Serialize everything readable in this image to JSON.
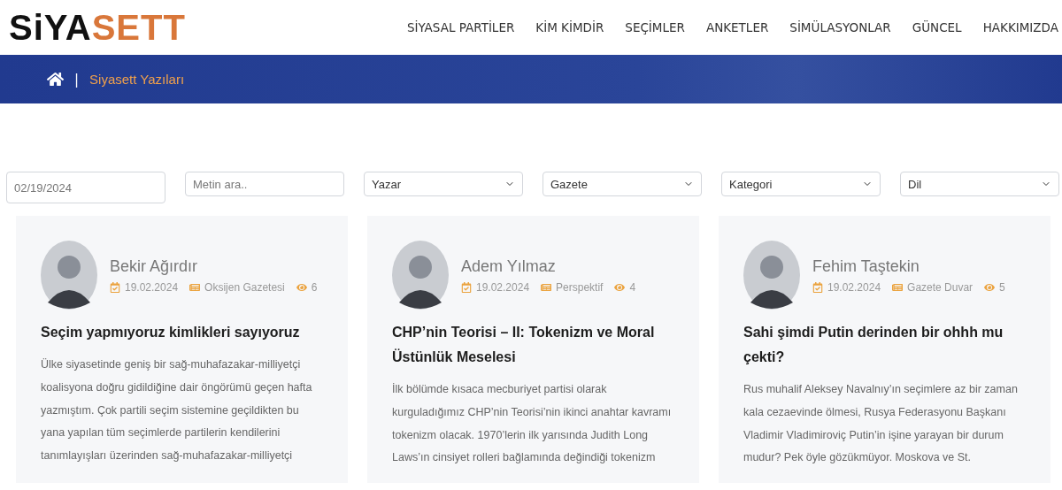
{
  "logo": {
    "dark": "SiYA",
    "accent": "SETT"
  },
  "nav": [
    "SİYASAL PARTİLER",
    "KİM KİMDİR",
    "SEÇİMLER",
    "ANKETLER",
    "SİMÜLASYONLAR",
    "GÜNCEL",
    "HAKKIMIZDA"
  ],
  "breadcrumb": {
    "separator": "|",
    "current": "Siyasett Yazıları"
  },
  "filters": [
    {
      "kind": "date",
      "placeholder": "02/19/2024"
    },
    {
      "kind": "text",
      "placeholder": "Metin ara.."
    },
    {
      "kind": "select",
      "value": "Yazar"
    },
    {
      "kind": "select",
      "value": "Gazete"
    },
    {
      "kind": "select",
      "value": "Kategori"
    },
    {
      "kind": "select",
      "value": "Dil"
    }
  ],
  "articles": [
    {
      "author": "Bekir Ağırdır",
      "date": "19.02.2024",
      "source": "Oksijen Gazetesi",
      "views": "6",
      "title": "Seçim yapmıyoruz kimlikleri sayıyoruz",
      "excerpt": "Ülke siyasetinde geniş bir sağ-muhafazakar-milliyetçi koalisyona doğru gidildiğine dair öngörümü geçen hafta yazmıştım. Çok partili seçim sistemine geçildikten bu yana yapılan tüm seçimlerde partilerin kendilerini tanımlayışları üzerinden sağ-muhafazakar-milliyetçi"
    },
    {
      "author": "Adem Yılmaz",
      "date": "19.02.2024",
      "source": "Perspektif",
      "views": "4",
      "title": "CHP’nin Teorisi – II: Tokenizm ve Moral Üstünlük Meselesi",
      "excerpt": "İlk bölümde kısaca mecburiyet partisi olarak kurguladığımız CHP’nin Teorisi’nin ikinci anahtar kavramı tokenizm olacak. 1970’lerin ilk yarısında Judith Long Laws’ın cinsiyet rolleri bağlamında değindiği tokenizm"
    },
    {
      "author": "Fehim Taştekin",
      "date": "19.02.2024",
      "source": "Gazete Duvar",
      "views": "5",
      "title": "Sahi şimdi Putin derinden bir ohhh mu çekti?",
      "excerpt": "Rus muhalif Aleksey Navalnıy’ın seçimlere az bir zaman kala cezaevinde ölmesi, Rusya Federasyonu Başkanı Vladimir Vladimiroviç Putin’in işine yarayan bir durum mudur? Pek öyle gözükmüyor. Moskova ve St."
    }
  ]
}
